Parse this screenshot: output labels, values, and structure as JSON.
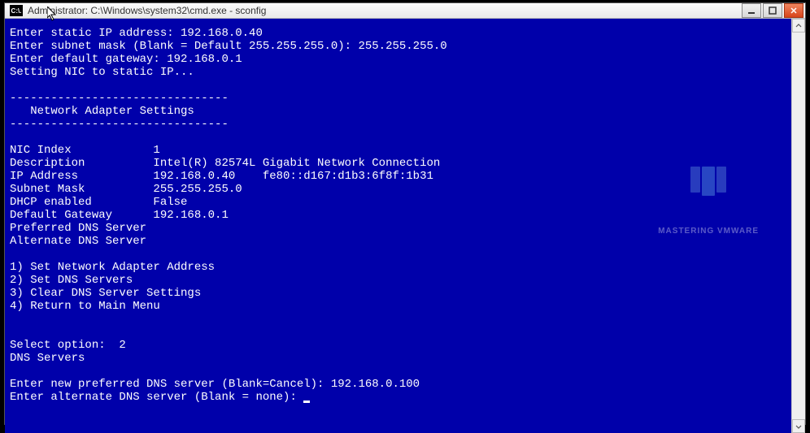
{
  "window": {
    "title": "Administrator: C:\\Windows\\system32\\cmd.exe - sconfig",
    "icon_label": "C:\\."
  },
  "terminal": {
    "line01": "Enter static IP address: 192.168.0.40",
    "line02": "Enter subnet mask (Blank = Default 255.255.255.0): 255.255.255.0",
    "line03": "Enter default gateway: 192.168.0.1",
    "line04": "Setting NIC to static IP...",
    "line05": "",
    "line06": "--------------------------------",
    "line07": "   Network Adapter Settings",
    "line08": "--------------------------------",
    "line09": "",
    "line10": "NIC Index            1",
    "line11": "Description          Intel(R) 82574L Gigabit Network Connection",
    "line12": "IP Address           192.168.0.40    fe80::d167:d1b3:6f8f:1b31",
    "line13": "Subnet Mask          255.255.255.0",
    "line14": "DHCP enabled         False",
    "line15": "Default Gateway      192.168.0.1",
    "line16": "Preferred DNS Server",
    "line17": "Alternate DNS Server",
    "line18": "",
    "line19": "1) Set Network Adapter Address",
    "line20": "2) Set DNS Servers",
    "line21": "3) Clear DNS Server Settings",
    "line22": "4) Return to Main Menu",
    "line23": "",
    "line24": "",
    "line25": "Select option:  2",
    "line26": "DNS Servers",
    "line27": "",
    "line28": "Enter new preferred DNS server (Blank=Cancel): 192.168.0.100",
    "line29": "Enter alternate DNS server (Blank = none): "
  },
  "watermark": {
    "text": "MASTERING VMWARE"
  }
}
